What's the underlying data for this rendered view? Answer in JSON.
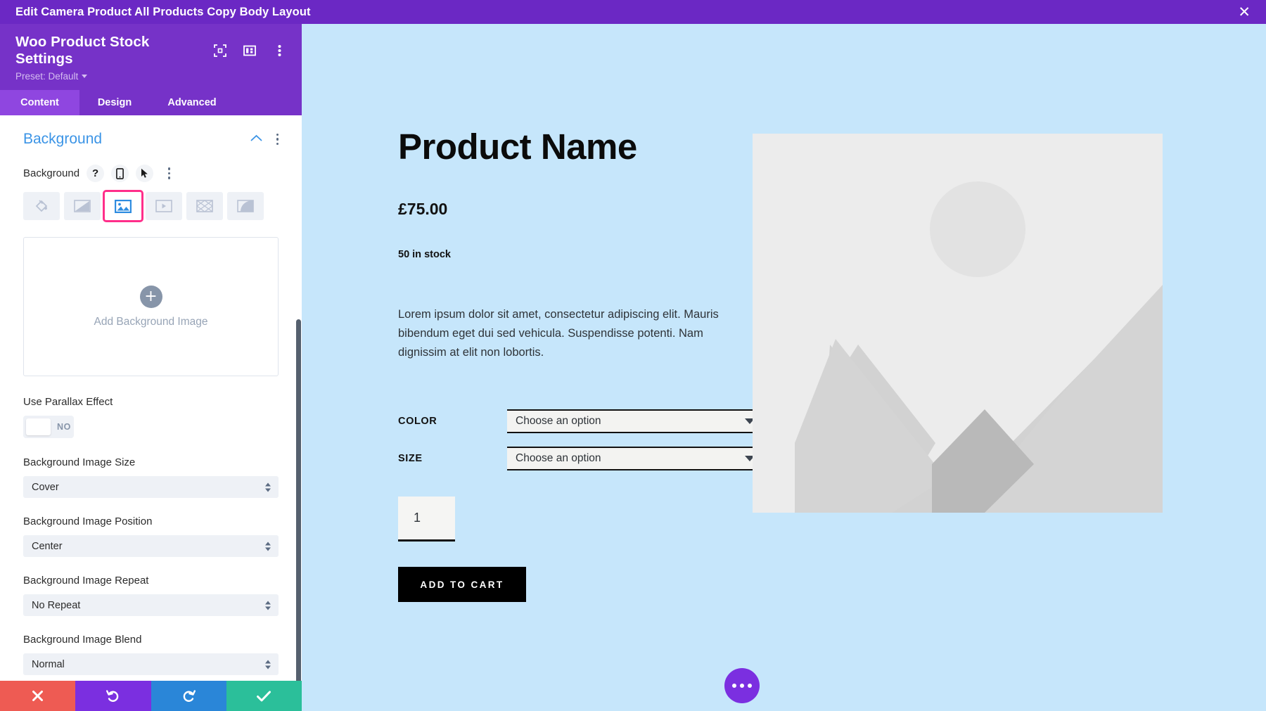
{
  "titlebar": {
    "text": "Edit Camera Product All Products Copy Body Layout",
    "close_label": "✕"
  },
  "panel": {
    "title": "Woo Product Stock Settings",
    "preset_label": "Preset: Default",
    "header_icons": [
      "fullscreen-icon",
      "layout-columns-icon",
      "more-vertical-icon"
    ],
    "tabs": [
      {
        "label": "Content",
        "active": true
      },
      {
        "label": "Design",
        "active": false
      },
      {
        "label": "Advanced",
        "active": false
      }
    ],
    "section": {
      "title": "Background",
      "collapse_icon": "chevron-up-icon",
      "more_icon": "more-vertical-icon"
    },
    "background_field": {
      "label": "Background",
      "controls": [
        "help-icon",
        "responsive-phone-icon",
        "hover-cursor-icon",
        "more-vertical-icon"
      ],
      "types": [
        {
          "name": "color",
          "selected": false
        },
        {
          "name": "gradient",
          "selected": false
        },
        {
          "name": "image",
          "selected": true,
          "highlighted": true
        },
        {
          "name": "video",
          "selected": false
        },
        {
          "name": "pattern",
          "selected": false
        },
        {
          "name": "mask",
          "selected": false
        }
      ]
    },
    "dropzone": {
      "text": "Add Background Image",
      "icon": "plus-icon"
    },
    "parallax": {
      "label": "Use Parallax Effect",
      "value": "NO",
      "on": false
    },
    "fields": [
      {
        "label": "Background Image Size",
        "value": "Cover"
      },
      {
        "label": "Background Image Position",
        "value": "Center"
      },
      {
        "label": "Background Image Repeat",
        "value": "No Repeat"
      },
      {
        "label": "Background Image Blend",
        "value": "Normal"
      }
    ],
    "actions": [
      {
        "name": "discard",
        "icon": "close-icon",
        "color": "#ee5b53"
      },
      {
        "name": "undo",
        "icon": "undo-icon",
        "color": "#7b2fe0"
      },
      {
        "name": "redo",
        "icon": "redo-icon",
        "color": "#2a86d8"
      },
      {
        "name": "save",
        "icon": "check-icon",
        "color": "#2bbf9a"
      }
    ]
  },
  "preview": {
    "background_color": "#c6e6fb",
    "product_title": "Product Name",
    "price": "£75.00",
    "stock": "50 in stock",
    "description": "Lorem ipsum dolor sit amet, consectetur adipiscing elit. Mauris bibendum eget dui sed vehicula. Suspendisse potenti. Nam dignissim at elit non lobortis.",
    "attributes": [
      {
        "name": "COLOR",
        "value": "Choose an option"
      },
      {
        "name": "SIZE",
        "value": "Choose an option"
      }
    ],
    "quantity": "1",
    "add_to_cart": "ADD TO CART",
    "image_placeholder": "product-image-placeholder",
    "fab": "more-options-fab"
  }
}
